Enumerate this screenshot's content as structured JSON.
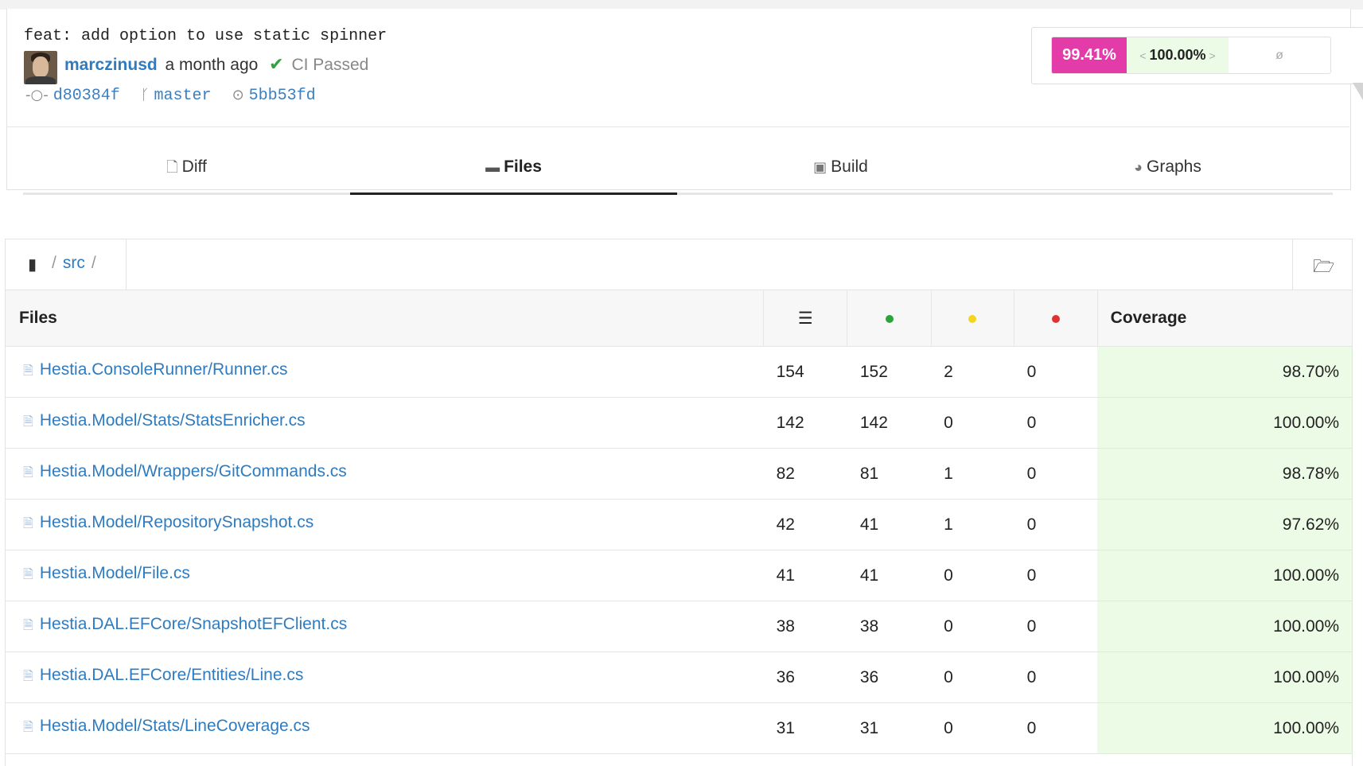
{
  "commit": {
    "message": "feat: add option to use static spinner",
    "author": "marczinusd",
    "time_ago": "a month ago",
    "ci_status": "CI Passed",
    "commit_sha": "d80384f",
    "branch": "master",
    "parent_sha": "5bb53fd"
  },
  "coverage_badge": {
    "head": "99.41%",
    "base": "100.00%",
    "delta": "ø",
    "colors": {
      "head_bg": "#e33ba8",
      "base_bg": "#ecfbe6"
    }
  },
  "tabs": [
    {
      "label": "Diff",
      "icon": "file-diff-icon"
    },
    {
      "label": "Files",
      "icon": "folder-icon",
      "active": true
    },
    {
      "label": "Build",
      "icon": "box-icon"
    },
    {
      "label": "Graphs",
      "icon": "pie-chart-icon"
    }
  ],
  "breadcrumb": {
    "root_icon": "repo-book-icon",
    "path": "src",
    "separator": "/"
  },
  "table": {
    "headers": {
      "files": "Files",
      "coverage": "Coverage",
      "lines_icon": "lines-icon"
    },
    "rows": [
      {
        "file": "Hestia.ConsoleRunner/Runner.cs",
        "lines": "154",
        "hit": "152",
        "partial": "2",
        "miss": "0",
        "coverage": "98.70%"
      },
      {
        "file": "Hestia.Model/Stats/StatsEnricher.cs",
        "lines": "142",
        "hit": "142",
        "partial": "0",
        "miss": "0",
        "coverage": "100.00%"
      },
      {
        "file": "Hestia.Model/Wrappers/GitCommands.cs",
        "lines": "82",
        "hit": "81",
        "partial": "1",
        "miss": "0",
        "coverage": "98.78%"
      },
      {
        "file": "Hestia.Model/RepositorySnapshot.cs",
        "lines": "42",
        "hit": "41",
        "partial": "1",
        "miss": "0",
        "coverage": "97.62%"
      },
      {
        "file": "Hestia.Model/File.cs",
        "lines": "41",
        "hit": "41",
        "partial": "0",
        "miss": "0",
        "coverage": "100.00%"
      },
      {
        "file": "Hestia.DAL.EFCore/SnapshotEFClient.cs",
        "lines": "38",
        "hit": "38",
        "partial": "0",
        "miss": "0",
        "coverage": "100.00%"
      },
      {
        "file": "Hestia.DAL.EFCore/Entities/Line.cs",
        "lines": "36",
        "hit": "36",
        "partial": "0",
        "miss": "0",
        "coverage": "100.00%"
      },
      {
        "file": "Hestia.Model/Stats/LineCoverage.cs",
        "lines": "31",
        "hit": "31",
        "partial": "0",
        "miss": "0",
        "coverage": "100.00%"
      }
    ]
  }
}
